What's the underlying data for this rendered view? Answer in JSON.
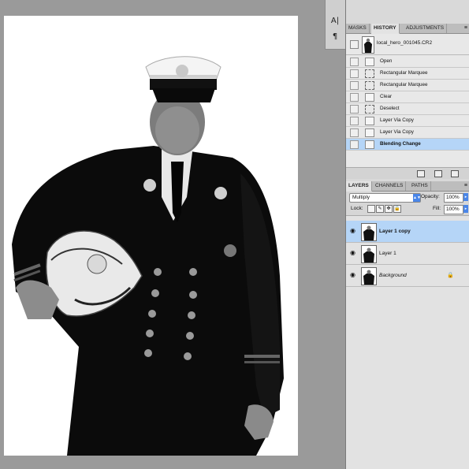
{
  "toolstrip": {
    "tool1_icon": "character-icon",
    "tool1_glyph": "A|",
    "tool2_icon": "paragraph-icon",
    "tool2_glyph": "¶"
  },
  "history_panel": {
    "tabs": [
      {
        "label": "MASKS"
      },
      {
        "label": "HISTORY"
      },
      {
        "label": "ADJUSTMENTS"
      }
    ],
    "snapshot_label": "local_hero_001045.CR2",
    "steps": [
      {
        "label": "Open",
        "icon": "document-icon"
      },
      {
        "label": "Rectangular Marquee",
        "icon": "marquee-icon"
      },
      {
        "label": "Rectangular Marquee",
        "icon": "marquee-icon"
      },
      {
        "label": "Clear",
        "icon": "document-icon"
      },
      {
        "label": "Deselect",
        "icon": "marquee-icon"
      },
      {
        "label": "Layer Via Copy",
        "icon": "document-icon"
      },
      {
        "label": "Layer Via Copy",
        "icon": "document-icon"
      },
      {
        "label": "Blending Change",
        "icon": "document-icon",
        "active": true
      }
    ]
  },
  "layers_panel": {
    "tabs": [
      {
        "label": "LAYERS"
      },
      {
        "label": "CHANNELS"
      },
      {
        "label": "PATHS"
      }
    ],
    "blend_mode": "Multiply",
    "opacity_label": "Opacity:",
    "opacity_value": "100%",
    "lock_label": "Lock:",
    "fill_label": "Fill:",
    "fill_value": "100%",
    "layers": [
      {
        "name": "Layer 1 copy",
        "active": true,
        "visible": true
      },
      {
        "name": "Layer 1",
        "active": false,
        "visible": true
      },
      {
        "name": "Background",
        "active": false,
        "visible": true,
        "locked": true
      }
    ]
  },
  "colors": {
    "selection": "#b5d5f7",
    "accent": "#4a86e8",
    "workspace": "#9a9a9a"
  }
}
